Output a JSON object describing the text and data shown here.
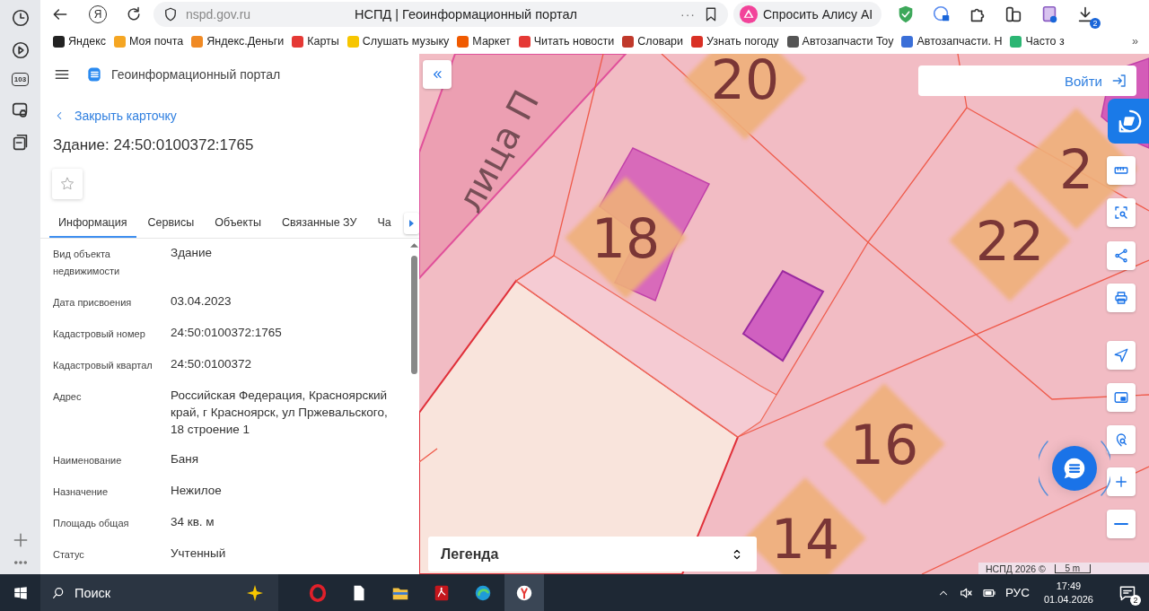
{
  "browser": {
    "sidebar_badge": "103",
    "yandex_letter": "Я",
    "url": "nspd.gov.ru",
    "page_title": "НСПД | Геоинформационный портал",
    "page_menu": "···",
    "alice": "Спросить Алису AI",
    "downloads_badge": "2"
  },
  "bookmarks": [
    {
      "label": "Яндекс",
      "color": "#222222"
    },
    {
      "label": "Моя почта",
      "color": "#f5a623"
    },
    {
      "label": "Яндекс.Деньги",
      "color": "#f08a24"
    },
    {
      "label": "Карты",
      "color": "#e53935"
    },
    {
      "label": "Слушать музыку",
      "color": "#f7c600"
    },
    {
      "label": "Маркет",
      "color": "#f05a00"
    },
    {
      "label": "Читать новости",
      "color": "#e53935"
    },
    {
      "label": "Словари",
      "color": "#c0392b"
    },
    {
      "label": "Узнать погоду",
      "color": "#d93025"
    },
    {
      "label": "Автозапчасти Toy",
      "color": "#555555"
    },
    {
      "label": "Автозапчасти. Н",
      "color": "#3a6fd8"
    },
    {
      "label": "Часто з",
      "color": "#2bb673"
    }
  ],
  "bookmarks_more": "»",
  "portal": {
    "title": "Геоинформационный портал",
    "close_link": "Закрыть карточку",
    "heading": "Здание: 24:50:0100372:1765"
  },
  "tabs": [
    {
      "label": "Информация",
      "selected": true
    },
    {
      "label": "Сервисы",
      "selected": false
    },
    {
      "label": "Объекты",
      "selected": false
    },
    {
      "label": "Связанные ЗУ",
      "selected": false
    },
    {
      "label": "Ча",
      "selected": false
    }
  ],
  "fields": [
    {
      "label": "Вид объекта недвижимости",
      "value": "Здание"
    },
    {
      "label": "Дата присвоения",
      "value": "03.04.2023"
    },
    {
      "label": "Кадастровый номер",
      "value": "24:50:0100372:1765"
    },
    {
      "label": "Кадастровый квартал",
      "value": "24:50:0100372"
    },
    {
      "label": "Адрес",
      "value": "Российская Федерация, Красноярский край, г Красноярск, ул Пржевальского, 18 строение 1"
    },
    {
      "label": "Наименование",
      "value": "Баня"
    },
    {
      "label": "Назначение",
      "value": "Нежилое"
    },
    {
      "label": "Площадь общая",
      "value": "34 кв. м"
    },
    {
      "label": "Статус",
      "value": "Учтенный"
    }
  ],
  "map": {
    "street": "лица П",
    "house_numbers": [
      "20",
      "18",
      "22",
      "2",
      "16",
      "14"
    ],
    "login": "Войти",
    "legend": "Легенда",
    "attribution": "НСПД 2026 ©",
    "scale": "5 m"
  },
  "taskbar": {
    "search": "Поиск",
    "language": "РУС",
    "time": "17:49",
    "date": "01.04.2026",
    "notifications": "2"
  }
}
